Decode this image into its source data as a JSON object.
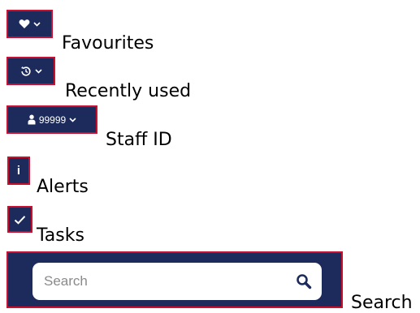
{
  "items": {
    "favourites": {
      "label": "Favourites",
      "icon": "heart-icon"
    },
    "recent": {
      "label": "Recently used",
      "icon": "history-icon"
    },
    "staff": {
      "label": "Staff ID",
      "id_value": "99999",
      "icon": "user-icon"
    },
    "alerts": {
      "label": "Alerts",
      "icon_text": "i"
    },
    "tasks": {
      "label": "Tasks",
      "icon": "checkmark-icon"
    },
    "search": {
      "label": "Search",
      "placeholder": "Search",
      "icon": "search-icon"
    }
  },
  "colors": {
    "navy": "#1c2b5c",
    "border_red": "#c8102e",
    "text": "#000000"
  }
}
